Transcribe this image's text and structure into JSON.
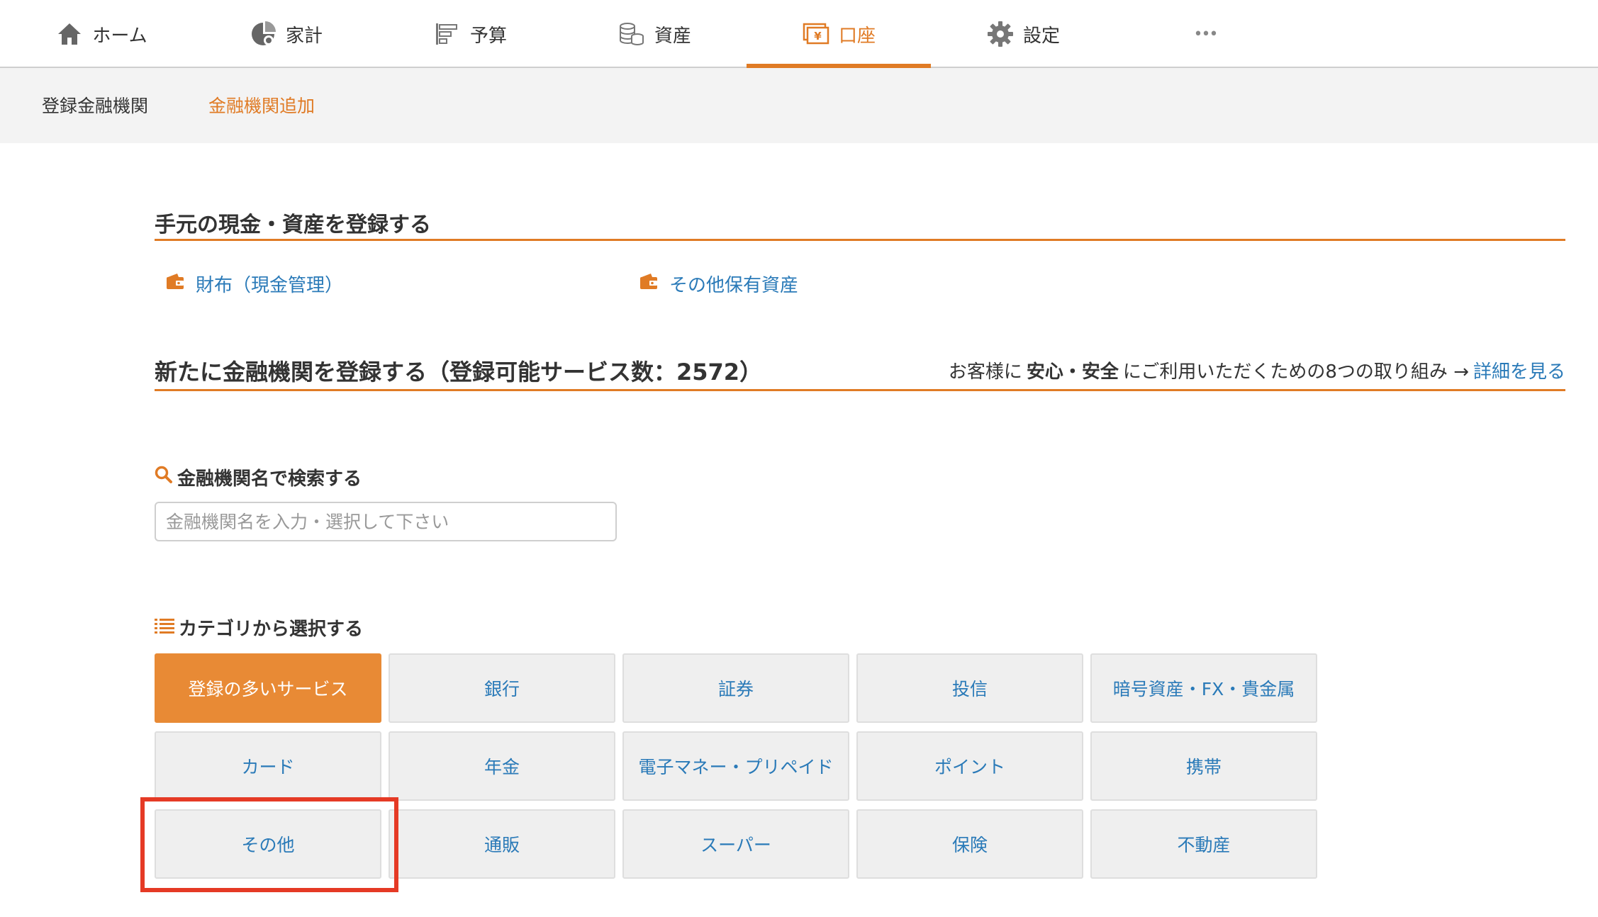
{
  "nav": {
    "items": [
      {
        "label": "ホーム",
        "icon": "home-icon"
      },
      {
        "label": "家計",
        "icon": "pie-chart-icon"
      },
      {
        "label": "予算",
        "icon": "budget-bars-icon"
      },
      {
        "label": "資産",
        "icon": "coins-stack-icon"
      },
      {
        "label": "口座",
        "icon": "yen-account-icon",
        "active": true
      },
      {
        "label": "設定",
        "icon": "gear-icon"
      },
      {
        "label": "•••",
        "icon": "more-dots-icon"
      }
    ]
  },
  "subnav": {
    "registered": "登録金融機関",
    "add": "金融機関追加"
  },
  "cash_section": {
    "title": "手元の現金・資産を登録する",
    "links": [
      {
        "label": "財布（現金管理）",
        "icon": "wallet-icon"
      },
      {
        "label": "その他保有資産",
        "icon": "wallet-icon"
      }
    ]
  },
  "register_section": {
    "title": "新たに金融機関を登録する（登録可能サービス数：2572）",
    "notice_prefix": "お客様に",
    "notice_bold": "安心・安全",
    "notice_suffix": "にご利用いただくための8つの取り組み →",
    "notice_link": "詳細を見る"
  },
  "search": {
    "heading": "金融機関名で検索する",
    "placeholder": "金融機関名を入力・選択して下さい"
  },
  "categories": {
    "heading": "カテゴリから選択する",
    "items": [
      "登録の多いサービス",
      "銀行",
      "証券",
      "投信",
      "暗号資産・FX・貴金属",
      "カード",
      "年金",
      "電子マネー・プリペイド",
      "ポイント",
      "携帯",
      "その他",
      "通販",
      "スーパー",
      "保険",
      "不動産"
    ],
    "selected_index": 0,
    "highlighted_index": 10
  },
  "colors": {
    "accent": "#e07b25",
    "link": "#2a7ab8",
    "highlight": "#e53a25"
  }
}
